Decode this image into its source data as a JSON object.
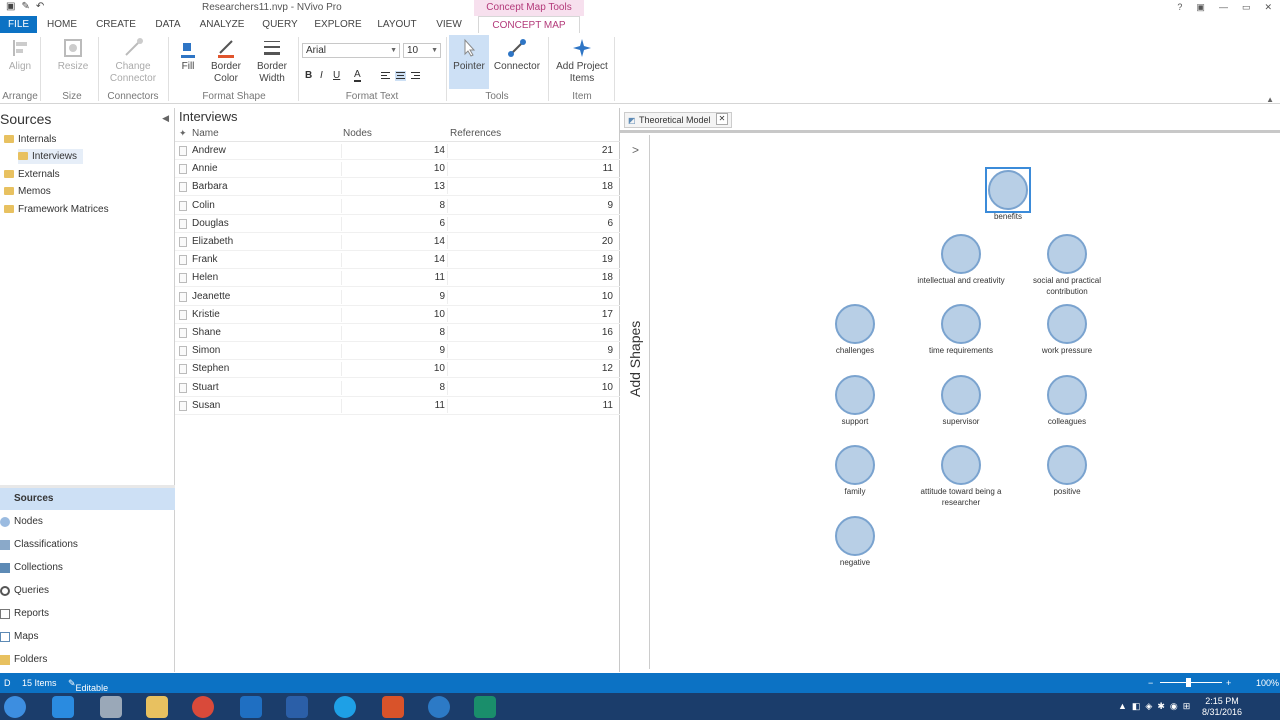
{
  "window": {
    "title": "Researchers11.nvp - NVivo Pro",
    "contextual_tab_group": "Concept Map Tools",
    "controls": [
      "?",
      "▣",
      "—",
      "▭",
      "✕"
    ]
  },
  "tabs": [
    "FILE",
    "HOME",
    "CREATE",
    "DATA",
    "ANALYZE",
    "QUERY",
    "EXPLORE",
    "LAYOUT",
    "VIEW",
    "CONCEPT MAP"
  ],
  "ribbon": {
    "align": "Align",
    "resize": "Resize",
    "change_connector_1": "Change",
    "change_connector_2": "Connector",
    "fill": "Fill",
    "border_color_1": "Border",
    "border_color_2": "Color",
    "border_width_1": "Border",
    "border_width_2": "Width",
    "font": "Arial",
    "font_size": "10",
    "bold": "B",
    "italic": "I",
    "underline": "U",
    "font_color": "A",
    "pointer": "Pointer",
    "connector": "Connector",
    "add_items_1": "Add Project",
    "add_items_2": "Items",
    "groups": {
      "arrange": "Arrange",
      "size": "Size",
      "connectors": "Connectors",
      "format_shape": "Format Shape",
      "format_text": "Format Text",
      "tools": "Tools",
      "item": "Item"
    }
  },
  "nav": {
    "header": "Sources",
    "tree": [
      "Internals",
      "Interviews",
      "Externals",
      "Memos",
      "Framework Matrices"
    ],
    "buttons": [
      "Sources",
      "Nodes",
      "Classifications",
      "Collections",
      "Queries",
      "Reports",
      "Maps",
      "Folders"
    ]
  },
  "list": {
    "title": "Interviews",
    "columns": [
      "Name",
      "Nodes",
      "References"
    ],
    "rows": [
      {
        "name": "Andrew",
        "nodes": "14",
        "refs": "21"
      },
      {
        "name": "Annie",
        "nodes": "10",
        "refs": "11"
      },
      {
        "name": "Barbara",
        "nodes": "13",
        "refs": "18"
      },
      {
        "name": "Colin",
        "nodes": "8",
        "refs": "9"
      },
      {
        "name": "Douglas",
        "nodes": "6",
        "refs": "6"
      },
      {
        "name": "Elizabeth",
        "nodes": "14",
        "refs": "20"
      },
      {
        "name": "Frank",
        "nodes": "14",
        "refs": "19"
      },
      {
        "name": "Helen",
        "nodes": "11",
        "refs": "18"
      },
      {
        "name": "Jeanette",
        "nodes": "9",
        "refs": "10"
      },
      {
        "name": "Kristie",
        "nodes": "10",
        "refs": "17"
      },
      {
        "name": "Shane",
        "nodes": "8",
        "refs": "16"
      },
      {
        "name": "Simon",
        "nodes": "9",
        "refs": "9"
      },
      {
        "name": "Stephen",
        "nodes": "10",
        "refs": "12"
      },
      {
        "name": "Stuart",
        "nodes": "8",
        "refs": "10"
      },
      {
        "name": "Susan",
        "nodes": "11",
        "refs": "11"
      }
    ]
  },
  "map": {
    "tab_title": "Theoretical Model",
    "add_shapes": "Add Shapes",
    "nodes": [
      {
        "id": "benefits",
        "label": "benefits"
      },
      {
        "id": "intellectual",
        "label": "intellectual and creativity"
      },
      {
        "id": "social",
        "label": "social and practical contribution"
      },
      {
        "id": "challenges",
        "label": "challenges"
      },
      {
        "id": "time",
        "label": "time requirements"
      },
      {
        "id": "work",
        "label": "work pressure"
      },
      {
        "id": "support",
        "label": "support"
      },
      {
        "id": "supervisor",
        "label": "supervisor"
      },
      {
        "id": "colleagues",
        "label": "colleagues"
      },
      {
        "id": "family",
        "label": "family"
      },
      {
        "id": "attitude",
        "label": "attitude toward being a researcher"
      },
      {
        "id": "positive",
        "label": "positive"
      },
      {
        "id": "negative",
        "label": "negative"
      }
    ]
  },
  "status": {
    "left_code": "D",
    "items": "15 Items",
    "editable": "Editable",
    "zoom": "100%"
  },
  "clock": {
    "time": "2:15 PM",
    "date": "8/31/2016"
  }
}
